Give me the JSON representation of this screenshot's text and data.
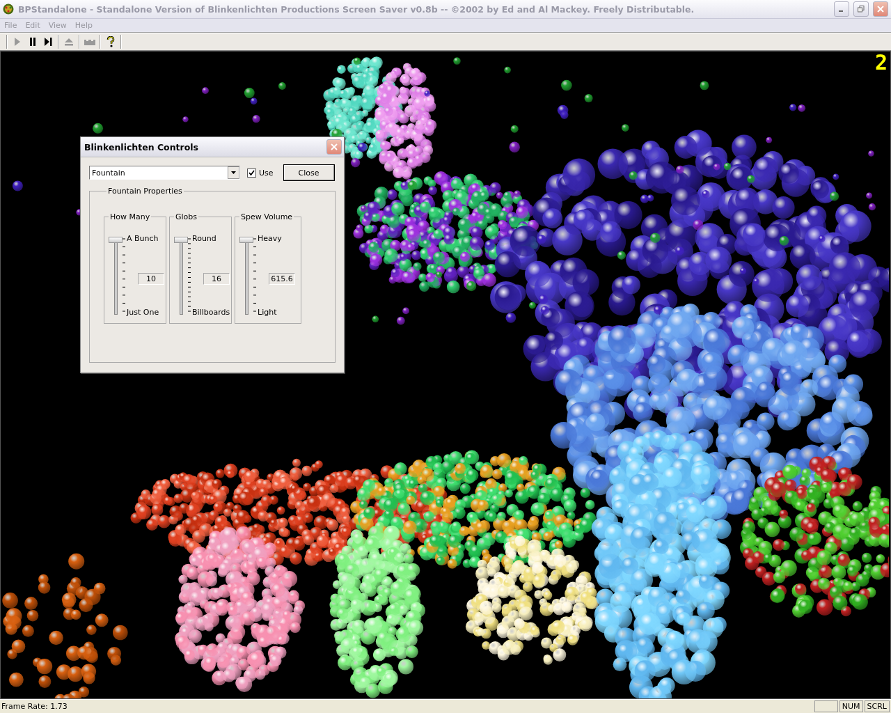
{
  "window": {
    "title": "BPStandalone - Standalone Version of Blinkenlichten Productions Screen Saver v0.8b  --  ©2002 by Ed and Al Mackey.   Freely Distributable.",
    "active": false
  },
  "menu": [
    "File",
    "Edit",
    "View",
    "Help"
  ],
  "toolbar": [
    {
      "kind": "play",
      "disabled": true
    },
    {
      "kind": "pause",
      "disabled": false
    },
    {
      "kind": "step",
      "disabled": false
    },
    {
      "kind": "eject",
      "disabled": true
    },
    {
      "kind": "castle",
      "disabled": true
    },
    {
      "kind": "help",
      "disabled": false
    }
  ],
  "scene": {
    "counter": "2"
  },
  "dialog": {
    "title": "Blinkenlichten Controls",
    "mode": "Fountain",
    "use_checked": true,
    "use_label": "Use",
    "close": "Close",
    "group_title": "Fountain Properties",
    "sliders": [
      {
        "title": "How Many",
        "top_label": "A Bunch",
        "bottom_label": "Just One",
        "value": "10",
        "level": 1
      },
      {
        "title": "Globs",
        "top_label": "Round",
        "bottom_label": "Billboards",
        "value": "16",
        "level": 1
      },
      {
        "title": "Spew Volume",
        "top_label": "Heavy",
        "bottom_label": "Light",
        "value": "615.6",
        "level": 1
      }
    ]
  },
  "status_bar": {
    "text": "Frame Rate: 1.73",
    "indicators": [
      "NUM",
      "SCRL"
    ]
  }
}
